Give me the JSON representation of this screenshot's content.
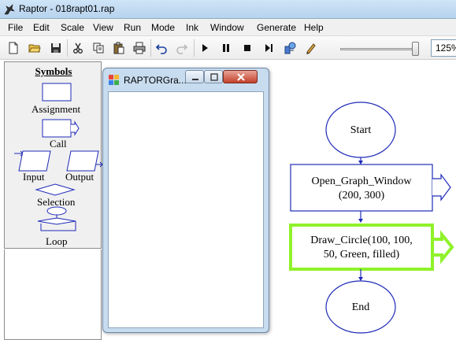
{
  "window": {
    "title": "Raptor - 018rapt01.rap"
  },
  "menu": [
    "File",
    "Edit",
    "Scale",
    "View",
    "Run",
    "Mode",
    "Ink",
    "Window",
    "Generate",
    "Help"
  ],
  "toolbar": {
    "buttons": [
      "new-file-icon",
      "open-folder-icon",
      "save-disk-icon",
      "cut-scissors-icon",
      "copy-icon",
      "paste-icon",
      "print-icon",
      "undo-icon",
      "redo-icon",
      "play-icon",
      "pause-icon",
      "stop-icon",
      "step-icon",
      "test-server-icon",
      "pen-ink-icon"
    ],
    "speed_fraction": 0.95,
    "zoom_value": "125%"
  },
  "symbols": {
    "heading": "Symbols",
    "assignment": "Assignment",
    "call": "Call",
    "input": "Input",
    "output": "Output",
    "selection": "Selection",
    "loop": "Loop"
  },
  "graph_window": {
    "title": "RAPTORGra..."
  },
  "flowchart": {
    "start": "Start",
    "step1_line1": "Open_Graph_Window",
    "step1_line2": "(200,  300)",
    "step2_line1": "Draw_Circle(100, 100,",
    "step2_line2": "50, Green, filled)",
    "end": "End"
  },
  "colors": {
    "flow_stroke": "#1e2ab8",
    "selected_border": "#8ff22a"
  }
}
